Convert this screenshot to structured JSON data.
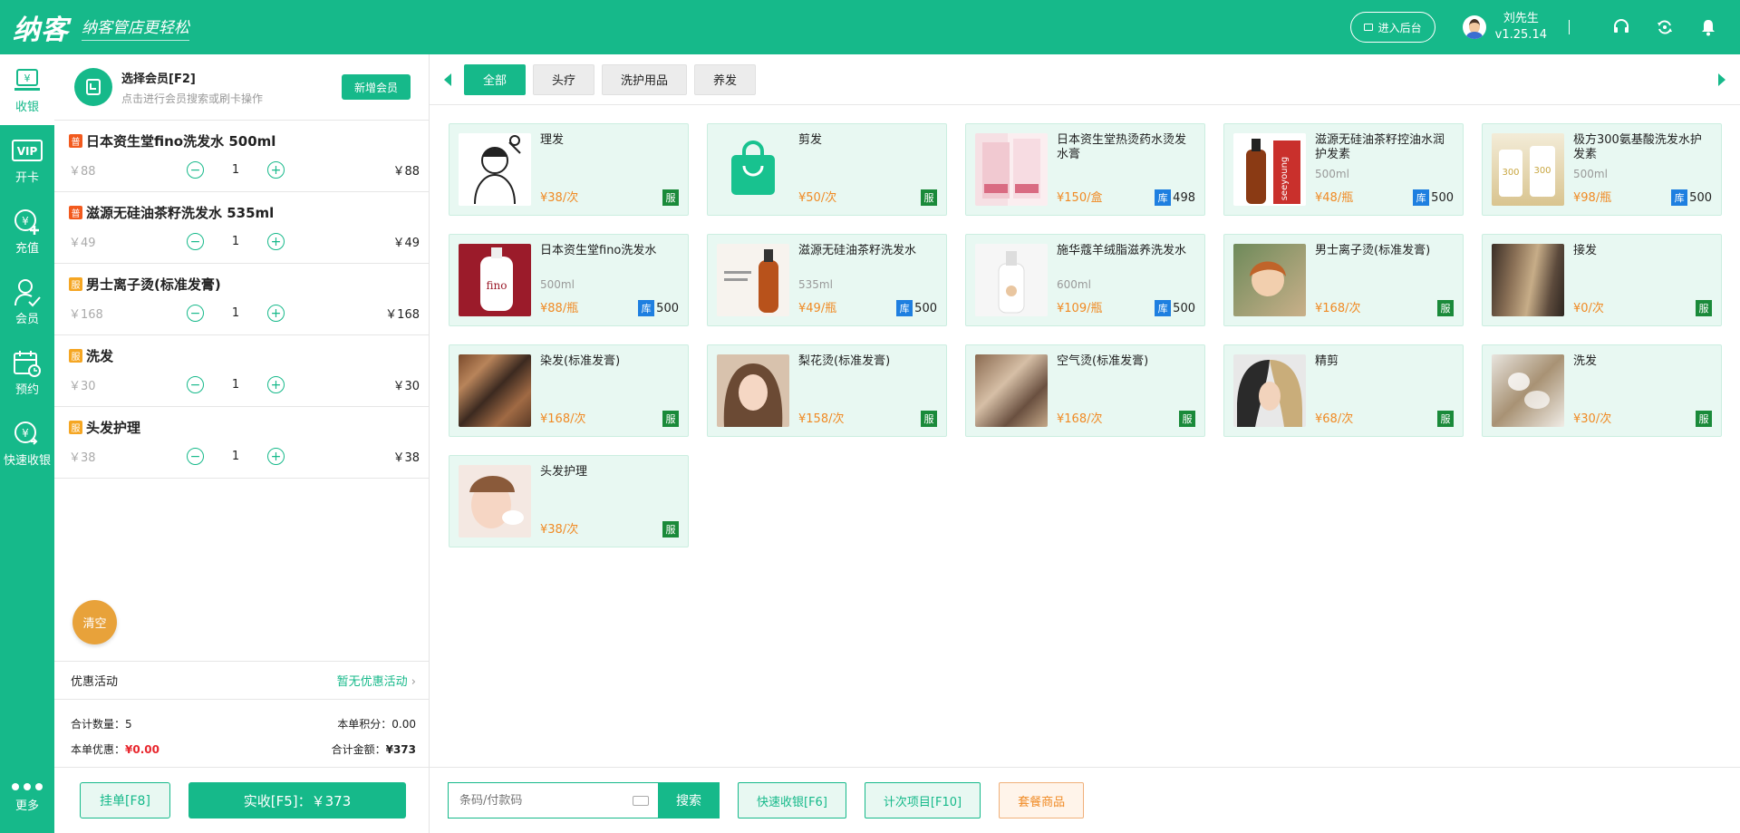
{
  "header": {
    "logo": "纳客",
    "slogan": "纳客管店更轻松",
    "backend_label": "进入后台",
    "user_name": "刘先生",
    "version": "v1.25.14"
  },
  "sidenav": {
    "items": [
      {
        "label": "收银"
      },
      {
        "label": "开卡"
      },
      {
        "label": "充值"
      },
      {
        "label": "会员"
      },
      {
        "label": "预约"
      },
      {
        "label": "快速收银"
      }
    ],
    "more_label": "更多"
  },
  "cart": {
    "member_title": "选择会员[F2]",
    "member_hint": "点击进行会员搜索或刷卡操作",
    "add_member_label": "新增会员",
    "items": [
      {
        "badge": "普",
        "name": "日本资生堂fino洗发水 500ml",
        "price": "￥88",
        "qty": "1",
        "total": "￥88"
      },
      {
        "badge": "普",
        "name": "滋源无硅油茶籽洗发水 535ml",
        "price": "￥49",
        "qty": "1",
        "total": "￥49"
      },
      {
        "badge": "服",
        "name": "男士离子烫(标准发膏)",
        "price": "￥168",
        "qty": "1",
        "total": "￥168"
      },
      {
        "badge": "服",
        "name": "洗发",
        "price": "￥30",
        "qty": "1",
        "total": "￥30"
      },
      {
        "badge": "服",
        "name": "头发护理",
        "price": "￥38",
        "qty": "1",
        "total": "￥38"
      }
    ],
    "clear_label": "清空",
    "promo_label": "优惠活动",
    "promo_value": "暂无优惠活动",
    "total_qty_label": "合计数量：",
    "total_qty": "5",
    "points_label": "本单积分：",
    "points": "0.00",
    "discount_label": "本单优惠：",
    "discount": "¥0.00",
    "amount_label": "合计金额：",
    "amount": "¥373",
    "hold_label": "挂单[F8]",
    "pay_label": "实收[F5]：￥373"
  },
  "categories": {
    "tabs": [
      "全部",
      "头疗",
      "洗护用品",
      "养发"
    ]
  },
  "products": [
    {
      "name": "理发",
      "spec": "",
      "price": "¥38/次",
      "tag": "服",
      "stock": ""
    },
    {
      "name": "剪发",
      "spec": "",
      "price": "¥50/次",
      "tag": "服",
      "stock": ""
    },
    {
      "name": "日本资生堂热烫药水烫发水膏",
      "spec": "",
      "price": "¥150/盒",
      "tag": "库",
      "stock": "498"
    },
    {
      "name": "滋源无硅油茶籽控油水润护发素",
      "spec": "500ml",
      "price": "¥48/瓶",
      "tag": "库",
      "stock": "500"
    },
    {
      "name": "极方300氨基酸洗发水护发素",
      "spec": "500ml",
      "price": "¥98/瓶",
      "tag": "库",
      "stock": "500"
    },
    {
      "name": "日本资生堂fino洗发水",
      "spec": "500ml",
      "price": "¥88/瓶",
      "tag": "库",
      "stock": "500"
    },
    {
      "name": "滋源无硅油茶籽洗发水",
      "spec": "535ml",
      "price": "¥49/瓶",
      "tag": "库",
      "stock": "500"
    },
    {
      "name": "施华蔻羊绒脂滋养洗发水",
      "spec": "600ml",
      "price": "¥109/瓶",
      "tag": "库",
      "stock": "500"
    },
    {
      "name": "男士离子烫(标准发膏)",
      "spec": "",
      "price": "¥168/次",
      "tag": "服",
      "stock": ""
    },
    {
      "name": "接发",
      "spec": "",
      "price": "¥0/次",
      "tag": "服",
      "stock": ""
    },
    {
      "name": "染发(标准发膏)",
      "spec": "",
      "price": "¥168/次",
      "tag": "服",
      "stock": ""
    },
    {
      "name": "梨花烫(标准发膏)",
      "spec": "",
      "price": "¥158/次",
      "tag": "服",
      "stock": ""
    },
    {
      "name": "空气烫(标准发膏)",
      "spec": "",
      "price": "¥168/次",
      "tag": "服",
      "stock": ""
    },
    {
      "name": "精剪",
      "spec": "",
      "price": "¥68/次",
      "tag": "服",
      "stock": ""
    },
    {
      "name": "洗发",
      "spec": "",
      "price": "¥30/次",
      "tag": "服",
      "stock": ""
    },
    {
      "name": "头发护理",
      "spec": "",
      "price": "¥38/次",
      "tag": "服",
      "stock": ""
    }
  ],
  "bottom": {
    "search_placeholder": "条码/付款码",
    "search_label": "搜索",
    "quick_label": "快速收银[F6]",
    "count_label": "计次项目[F10]",
    "package_label": "套餐商品"
  },
  "colors": {
    "brand": "#16b98a",
    "price": "#f08a24",
    "service_tag": "#1a8a3a",
    "stock_tag": "#1e7fe0",
    "discount": "#e8262d"
  }
}
